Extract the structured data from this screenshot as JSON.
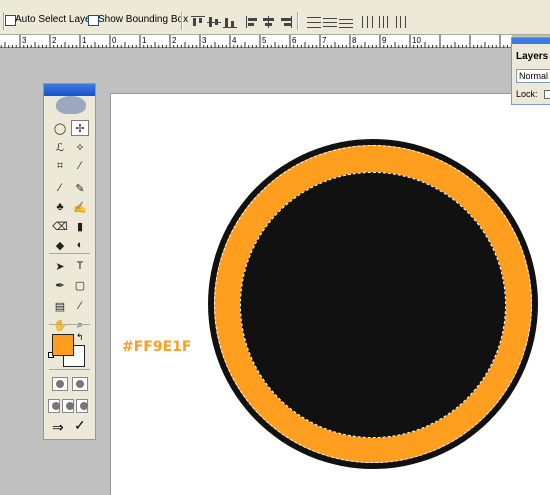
{
  "options_bar": {
    "auto_select_label": "Auto Select Layer",
    "show_bounding_box_label": "Show Bounding Box"
  },
  "ruler": {
    "labels": [
      "3",
      "2",
      "1",
      "0",
      "1",
      "2",
      "3",
      "4",
      "5",
      "6",
      "7",
      "8",
      "9",
      "10"
    ]
  },
  "toolbox": {
    "foreground_color": "#ff9e1f",
    "background_color": "#ffffff",
    "tools": [
      {
        "name": "elliptical-marquee-icon",
        "glyph": "◯"
      },
      {
        "name": "move-tool-icon",
        "glyph": "✢"
      },
      {
        "name": "lasso-icon",
        "glyph": "ℒ"
      },
      {
        "name": "magic-wand-icon",
        "glyph": "✧"
      },
      {
        "name": "crop-icon",
        "glyph": "⌗"
      },
      {
        "name": "slice-icon",
        "glyph": "⁄"
      },
      {
        "name": "healing-brush-icon",
        "glyph": "∕"
      },
      {
        "name": "brush-icon",
        "glyph": "✎"
      },
      {
        "name": "clone-stamp-icon",
        "glyph": "♣"
      },
      {
        "name": "history-brush-icon",
        "glyph": "✍"
      },
      {
        "name": "eraser-icon",
        "glyph": "⌫"
      },
      {
        "name": "gradient-icon",
        "glyph": "▮"
      },
      {
        "name": "blur-icon",
        "glyph": "◆"
      },
      {
        "name": "dodge-icon",
        "glyph": "◐"
      },
      {
        "name": "path-selection-icon",
        "glyph": "➤"
      },
      {
        "name": "type-tool-icon",
        "glyph": "T"
      },
      {
        "name": "pen-tool-icon",
        "glyph": "✒"
      },
      {
        "name": "shape-tool-icon",
        "glyph": "▢"
      },
      {
        "name": "notes-icon",
        "glyph": "▤"
      },
      {
        "name": "eyedropper-icon",
        "glyph": "⁄"
      },
      {
        "name": "hand-tool-icon",
        "glyph": "✋"
      },
      {
        "name": "zoom-icon",
        "glyph": "⌕"
      }
    ]
  },
  "canvas": {
    "hex_label": "#FF9E1F",
    "ring_color": "#ff9e1f",
    "fill_color": "#111111"
  },
  "layers_panel": {
    "tab_label": "Layers",
    "blend_mode": "Normal",
    "lock_label": "Lock:"
  }
}
